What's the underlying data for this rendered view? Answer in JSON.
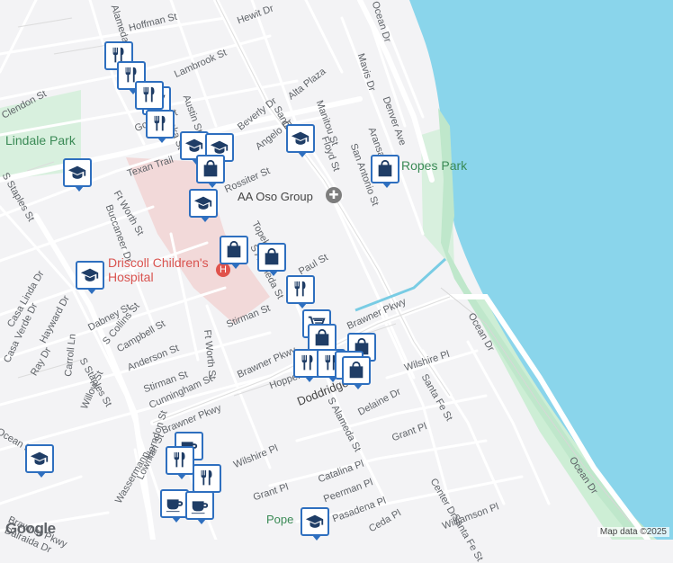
{
  "map": {
    "streets": {
      "hoffman": "Hoffman St",
      "hewit": "Hewit Dr",
      "alameda_top": "Alameda St",
      "lambrook": "Lambrook St",
      "clendon": "Clendon St",
      "austin": "Austin St",
      "topeka": "Topeka St",
      "gordon": "Gordon St",
      "beverly": "Beverly Dr",
      "alta_plaza": "Alta Plaza",
      "santa_fe_top": "Santa Fe St",
      "angelo": "Angelo Dr",
      "manitou": "Manitou St",
      "mavis": "Mavis Dr",
      "denver": "Denver Ave",
      "floyd": "Floyd St",
      "aransas": "Aransas St",
      "san_antonio": "San Antonio St",
      "texan_trail": "Texan Trail",
      "rossiter": "Rossiter St",
      "ocean_dr_top": "Ocean Dr",
      "s_staples_top": "S Staples St",
      "ft_worth_top": "Ft Worth St",
      "buccaneer": "Buccaneer Dr",
      "topeka2": "Topeka St",
      "s_alameda": "S Alameda St",
      "paul": "Paul St",
      "casa_linda": "Casa Linda Dr",
      "dabney": "Dabney St",
      "collins": "S Collins St",
      "campbell": "Campbell St",
      "casa_verde": "Casa Verde Dr",
      "hayward": "Hayward Dr",
      "anderson": "Anderson St",
      "stirman": "Stirman St",
      "stirman2": "Stirman St",
      "ft_worth2": "Ft Worth St",
      "ray": "Ray Dr",
      "carroll": "Carroll Ln",
      "s_staples2": "S Staples St",
      "cunningham": "Cunningham St",
      "brawner": "Brawner Pkwy",
      "brawner2": "Brawner Pkwy",
      "brawner3": "Brawner Pkwy",
      "hopper": "Hopper St",
      "ocean_dr2": "Ocean Dr",
      "wilshire": "Wilshire Pl",
      "santa_fe2": "Santa Fe St",
      "doddridge": "Doddridge St",
      "s_alameda2": "S Alameda St",
      "delaine": "Delaine Dr",
      "grant": "Grant Pl",
      "willow": "Willow St",
      "ocean_ln": "Ocean Ln",
      "herndon": "Herndon St",
      "lowman": "Lowman St",
      "wilshire2": "Wilshire Pl",
      "wassermann": "Wassermann",
      "catalina": "Catalina Pl",
      "grant2": "Grant Pl",
      "peerman": "Peerman Pl",
      "center": "Center Dr",
      "ocean_dr3": "Ocean Dr",
      "pasadena": "Pasadena Pl",
      "williamson": "Williamson Pl",
      "brawner4": "Brawner Pkwy",
      "dalraida": "Dalraida Dr",
      "santa_fe3": "Santa Fe St",
      "ceda": "Ceda Pl"
    },
    "parks": {
      "lindale": "Lindale Park",
      "ropes": "Ropes Park"
    },
    "pois": {
      "aa_oso": "AA Oso Group",
      "pope": "Pope"
    },
    "hospital": "Driscoll Children's Hospital",
    "attribution": "Map data ©2025",
    "logo": "Google",
    "colors": {
      "water": "#8ad5eb",
      "park": "#c9ebd3",
      "road": "#ffffff",
      "land": "#f3f3f5",
      "marker": "#2e6fbf",
      "icon": "#1f3d66",
      "hospital": "#f3d3d3"
    }
  }
}
